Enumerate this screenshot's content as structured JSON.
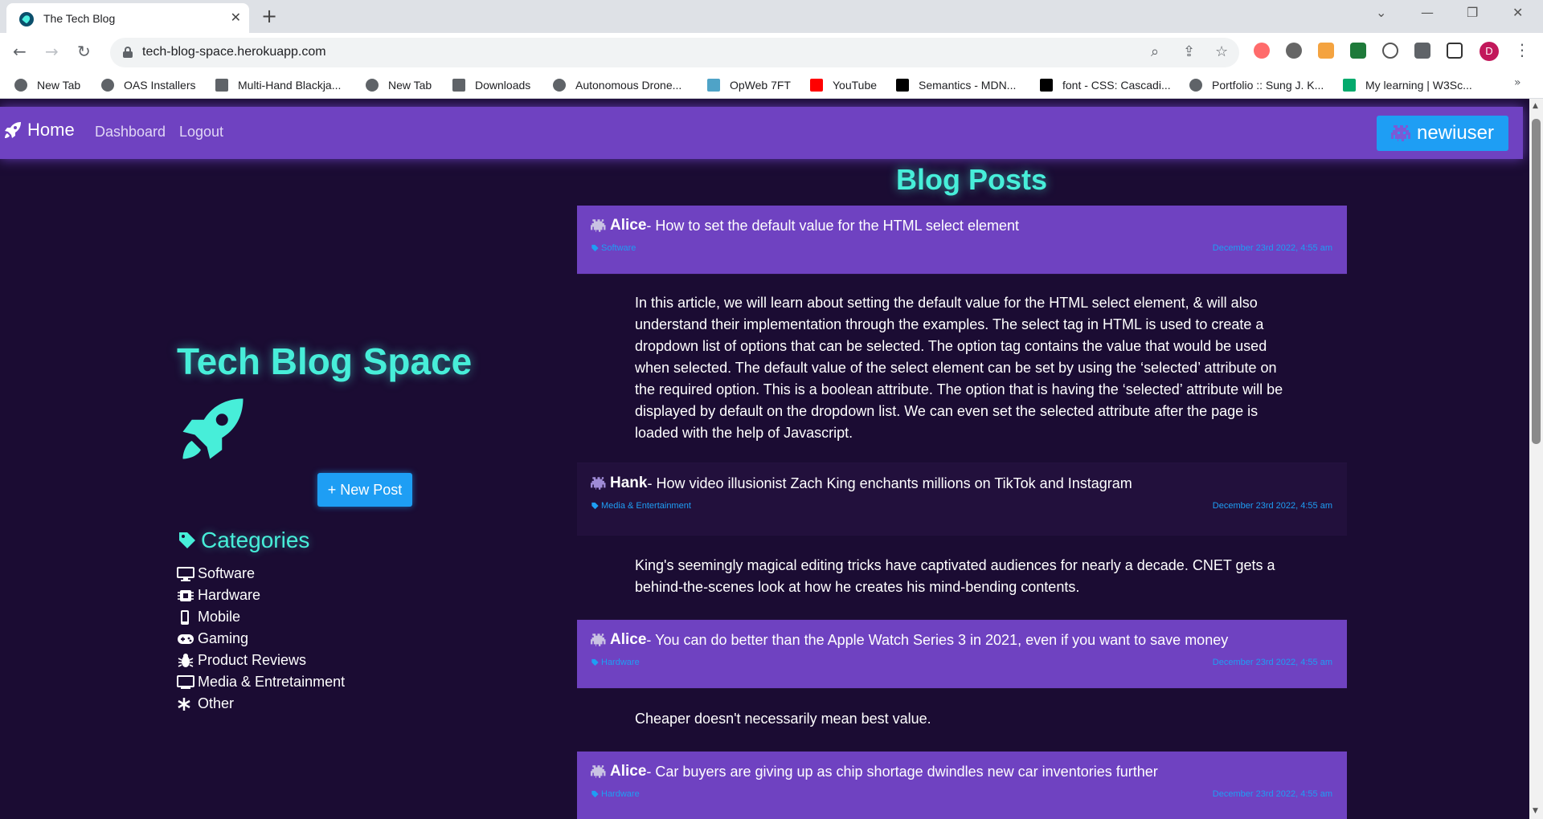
{
  "browser": {
    "tab_title": "The Tech Blog",
    "url": "tech-blog-space.herokuapp.com",
    "profile_initial": "D",
    "bookmarks": [
      {
        "label": "New Tab"
      },
      {
        "label": "OAS Installers"
      },
      {
        "label": "Multi-Hand Blackja..."
      },
      {
        "label": "New Tab"
      },
      {
        "label": "Downloads"
      },
      {
        "label": "Autonomous Drone..."
      },
      {
        "label": "OpWeb 7FT"
      },
      {
        "label": "YouTube"
      },
      {
        "label": "Semantics - MDN..."
      },
      {
        "label": "font - CSS: Cascadi..."
      },
      {
        "label": "Portfolio :: Sung J. K..."
      },
      {
        "label": "My learning | W3Sc..."
      }
    ],
    "more_bookmarks": "»"
  },
  "nav": {
    "brand": "Home",
    "links": [
      "Dashboard",
      "Logout"
    ],
    "username": "newiuser"
  },
  "sidebar": {
    "title": "Tech Blog Space",
    "new_post_label": "+ New Post",
    "categories_heading": "Categories",
    "categories": [
      {
        "label": "Software",
        "icon": "desktop-icon"
      },
      {
        "label": "Hardware",
        "icon": "chip-icon"
      },
      {
        "label": "Mobile",
        "icon": "phone-icon"
      },
      {
        "label": "Gaming",
        "icon": "gamepad-icon"
      },
      {
        "label": "Product Reviews",
        "icon": "bug-icon"
      },
      {
        "label": "Media & Entretainment",
        "icon": "tv-icon"
      },
      {
        "label": "Other",
        "icon": "asterisk-icon"
      }
    ]
  },
  "posts_heading": "Blog Posts",
  "posts": [
    {
      "author": "Alice",
      "title": " - How to set the default value for the HTML select element",
      "category": "Software",
      "date": "December 23rd 2022, 4:55 am",
      "body": "In this article, we will learn about setting the default value for the HTML select element, & will also understand their implementation through the examples. The select tag in HTML is used to create a dropdown list of options that can be selected. The option tag contains the value that would be used when selected. The default value of the select element can be set by using the ‘selected’ attribute on the required option. This is a boolean attribute. The option that is having the ‘selected’ attribute will be displayed by default on the dropdown list. We can even set the selected attribute after the page is loaded with the help of Javascript."
    },
    {
      "author": "Hank",
      "title": " - How video illusionist Zach King enchants millions on TikTok and Instagram",
      "category": "Media & Entertainment",
      "date": "December 23rd 2022, 4:55 am",
      "body": "King's seemingly magical editing tricks have captivated audiences for nearly a decade. CNET gets a behind-the-scenes look at how he creates his mind-bending contents."
    },
    {
      "author": "Alice",
      "title": " - You can do better than the Apple Watch Series 3 in 2021, even if you want to save money",
      "category": "Hardware",
      "date": "December 23rd 2022, 4:55 am",
      "body": "Cheaper doesn't necessarily mean best value."
    },
    {
      "author": "Alice",
      "title": " - Car buyers are giving up as chip shortage dwindles new car inventories further",
      "category": "Hardware",
      "date": "December 23rd 2022, 4:55 am",
      "body": ""
    }
  ],
  "colors": {
    "accent_teal": "#47eed9",
    "navbar_purple": "#6f42c1",
    "button_blue": "#1e9ef4",
    "page_bg": "#1b0c33"
  }
}
